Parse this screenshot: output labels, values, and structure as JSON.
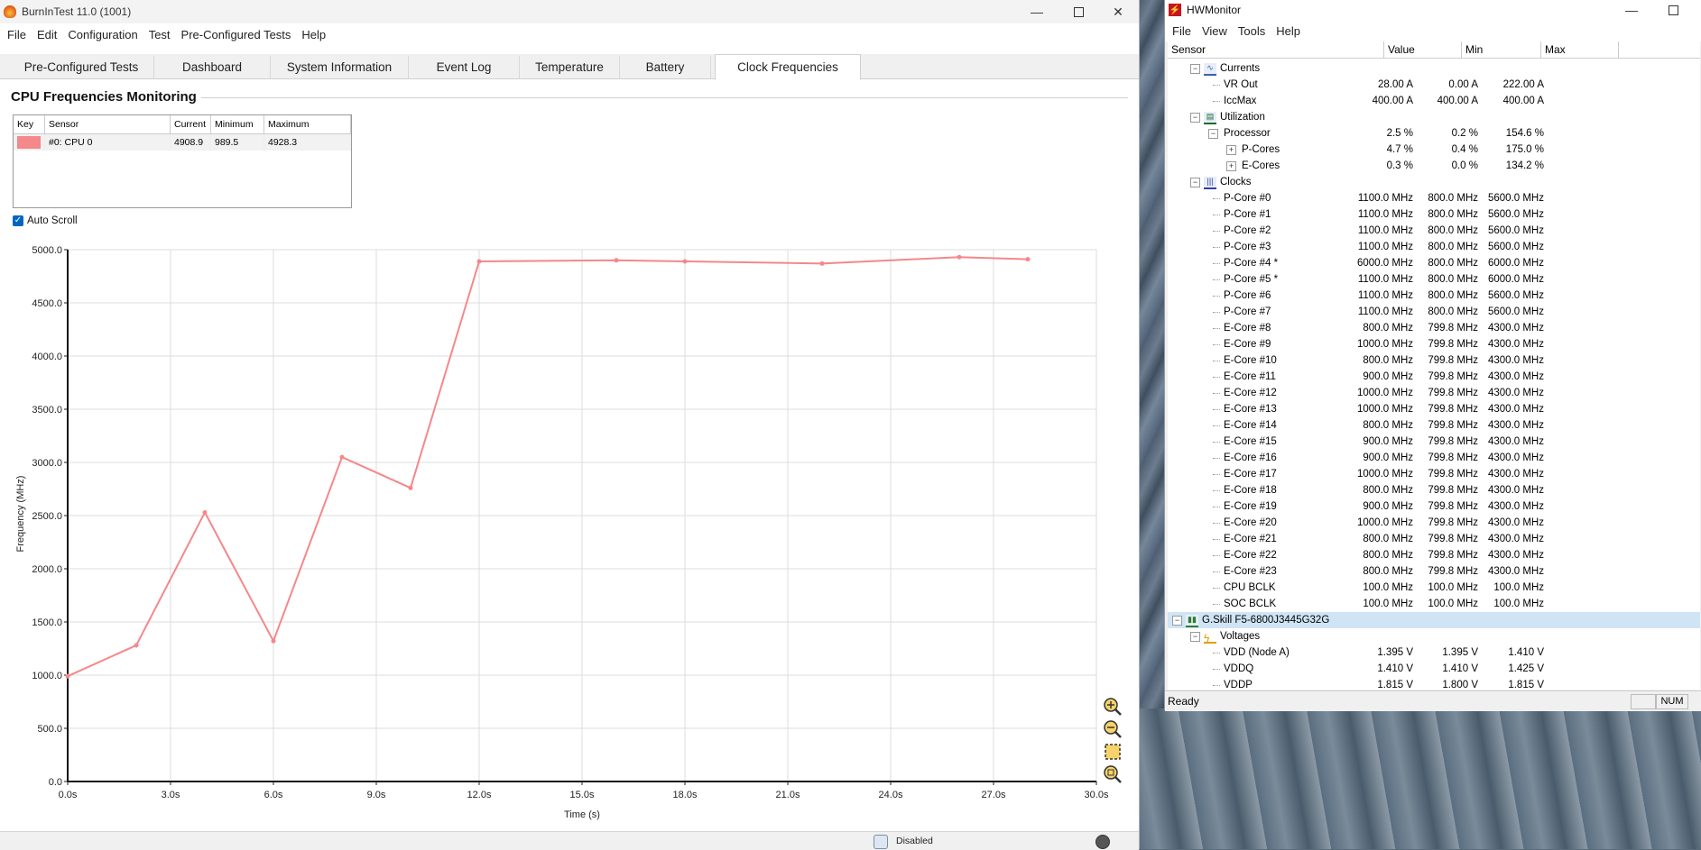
{
  "burnintest": {
    "title": "BurnInTest 11.0 (1001)",
    "menu": [
      "File",
      "Edit",
      "Configuration",
      "Test",
      "Pre-Configured Tests",
      "Help"
    ],
    "tabs": [
      "Pre-Configured Tests",
      "Dashboard",
      "System Information",
      "Event Log",
      "Temperature",
      "Battery",
      "Clock Frequencies"
    ],
    "active_tab": "Clock Frequencies",
    "section_title": "CPU Frequencies Monitoring",
    "sensor_table": {
      "headers": [
        "Key",
        "Sensor",
        "Current",
        "Minimum",
        "Maximum"
      ],
      "row": {
        "key_color": "#f4888a",
        "sensor": "#0: CPU 0",
        "current": "4908.9",
        "minimum": "989.5",
        "maximum": "4928.3"
      }
    },
    "auto_scroll_label": "Auto Scroll",
    "auto_scroll_checked": true,
    "status": {
      "text": "Disabled"
    }
  },
  "chart_data": {
    "type": "line",
    "xlabel": "Time (s)",
    "ylabel": "Frequency (MHz)",
    "xlim": [
      0,
      30
    ],
    "ylim": [
      0,
      5000
    ],
    "x_ticks": [
      "0.0s",
      "3.0s",
      "6.0s",
      "9.0s",
      "12.0s",
      "15.0s",
      "18.0s",
      "21.0s",
      "24.0s",
      "27.0s",
      "30.0s"
    ],
    "y_ticks": [
      "0.0",
      "500.0",
      "1000.0",
      "1500.0",
      "2000.0",
      "2500.0",
      "3000.0",
      "3500.0",
      "4000.0",
      "4500.0",
      "5000.0"
    ],
    "grid": true,
    "series": [
      {
        "color": "#f4888a",
        "x": [
          0,
          2,
          4,
          6,
          8,
          10,
          12,
          16,
          18,
          22,
          26,
          28
        ],
        "y": [
          990,
          1280,
          2530,
          1320,
          3050,
          2760,
          4890,
          4900,
          4890,
          4870,
          4930,
          4910
        ]
      }
    ]
  },
  "hwmonitor": {
    "title": "HWMonitor",
    "menu": [
      "File",
      "View",
      "Tools",
      "Help"
    ],
    "columns": [
      "Sensor",
      "Value",
      "Min",
      "Max"
    ],
    "rows": [
      {
        "level": 2,
        "type": "group",
        "icon": "currents",
        "label": "Currents",
        "toggle": "-"
      },
      {
        "level": 3,
        "label": "VR Out",
        "value": "28.00 A",
        "min": "0.00 A",
        "max": "222.00 A"
      },
      {
        "level": 3,
        "label": "IccMax",
        "value": "400.00 A",
        "min": "400.00 A",
        "max": "400.00 A"
      },
      {
        "level": 2,
        "type": "group",
        "icon": "utilization",
        "label": "Utilization",
        "toggle": "-"
      },
      {
        "level": 3,
        "label": "Processor",
        "value": "2.5 %",
        "min": "0.2 %",
        "max": "154.6 %",
        "toggle": "-"
      },
      {
        "level": 4,
        "label": "P-Cores",
        "value": "4.7 %",
        "min": "0.4 %",
        "max": "175.0 %",
        "toggle": "+"
      },
      {
        "level": 4,
        "label": "E-Cores",
        "value": "0.3 %",
        "min": "0.0 %",
        "max": "134.2 %",
        "toggle": "+"
      },
      {
        "level": 2,
        "type": "group",
        "icon": "clocks",
        "label": "Clocks",
        "toggle": "-"
      },
      {
        "level": 3,
        "label": "P-Core #0",
        "value": "1100.0 MHz",
        "min": "800.0 MHz",
        "max": "5600.0 MHz"
      },
      {
        "level": 3,
        "label": "P-Core #1",
        "value": "1100.0 MHz",
        "min": "800.0 MHz",
        "max": "5600.0 MHz"
      },
      {
        "level": 3,
        "label": "P-Core #2",
        "value": "1100.0 MHz",
        "min": "800.0 MHz",
        "max": "5600.0 MHz"
      },
      {
        "level": 3,
        "label": "P-Core #3",
        "value": "1100.0 MHz",
        "min": "800.0 MHz",
        "max": "5600.0 MHz"
      },
      {
        "level": 3,
        "label": "P-Core #4 *",
        "value": "6000.0 MHz",
        "min": "800.0 MHz",
        "max": "6000.0 MHz"
      },
      {
        "level": 3,
        "label": "P-Core #5 *",
        "value": "1100.0 MHz",
        "min": "800.0 MHz",
        "max": "6000.0 MHz"
      },
      {
        "level": 3,
        "label": "P-Core #6",
        "value": "1100.0 MHz",
        "min": "800.0 MHz",
        "max": "5600.0 MHz"
      },
      {
        "level": 3,
        "label": "P-Core #7",
        "value": "1100.0 MHz",
        "min": "800.0 MHz",
        "max": "5600.0 MHz"
      },
      {
        "level": 3,
        "label": "E-Core #8",
        "value": "800.0 MHz",
        "min": "799.8 MHz",
        "max": "4300.0 MHz"
      },
      {
        "level": 3,
        "label": "E-Core #9",
        "value": "1000.0 MHz",
        "min": "799.8 MHz",
        "max": "4300.0 MHz"
      },
      {
        "level": 3,
        "label": "E-Core #10",
        "value": "800.0 MHz",
        "min": "799.8 MHz",
        "max": "4300.0 MHz"
      },
      {
        "level": 3,
        "label": "E-Core #11",
        "value": "900.0 MHz",
        "min": "799.8 MHz",
        "max": "4300.0 MHz"
      },
      {
        "level": 3,
        "label": "E-Core #12",
        "value": "1000.0 MHz",
        "min": "799.8 MHz",
        "max": "4300.0 MHz"
      },
      {
        "level": 3,
        "label": "E-Core #13",
        "value": "1000.0 MHz",
        "min": "799.8 MHz",
        "max": "4300.0 MHz"
      },
      {
        "level": 3,
        "label": "E-Core #14",
        "value": "800.0 MHz",
        "min": "799.8 MHz",
        "max": "4300.0 MHz"
      },
      {
        "level": 3,
        "label": "E-Core #15",
        "value": "900.0 MHz",
        "min": "799.8 MHz",
        "max": "4300.0 MHz"
      },
      {
        "level": 3,
        "label": "E-Core #16",
        "value": "900.0 MHz",
        "min": "799.8 MHz",
        "max": "4300.0 MHz"
      },
      {
        "level": 3,
        "label": "E-Core #17",
        "value": "1000.0 MHz",
        "min": "799.8 MHz",
        "max": "4300.0 MHz"
      },
      {
        "level": 3,
        "label": "E-Core #18",
        "value": "800.0 MHz",
        "min": "799.8 MHz",
        "max": "4300.0 MHz"
      },
      {
        "level": 3,
        "label": "E-Core #19",
        "value": "900.0 MHz",
        "min": "799.8 MHz",
        "max": "4300.0 MHz"
      },
      {
        "level": 3,
        "label": "E-Core #20",
        "value": "1000.0 MHz",
        "min": "799.8 MHz",
        "max": "4300.0 MHz"
      },
      {
        "level": 3,
        "label": "E-Core #21",
        "value": "800.0 MHz",
        "min": "799.8 MHz",
        "max": "4300.0 MHz"
      },
      {
        "level": 3,
        "label": "E-Core #22",
        "value": "800.0 MHz",
        "min": "799.8 MHz",
        "max": "4300.0 MHz"
      },
      {
        "level": 3,
        "label": "E-Core #23",
        "value": "800.0 MHz",
        "min": "799.8 MHz",
        "max": "4300.0 MHz"
      },
      {
        "level": 3,
        "label": "CPU BCLK",
        "value": "100.0 MHz",
        "min": "100.0 MHz",
        "max": "100.0 MHz"
      },
      {
        "level": 3,
        "label": "SOC BCLK",
        "value": "100.0 MHz",
        "min": "100.0 MHz",
        "max": "100.0 MHz"
      },
      {
        "level": 1,
        "type": "device",
        "icon": "memory",
        "label": "G.Skill F5-6800J3445G32G",
        "toggle": "-",
        "highlight": true
      },
      {
        "level": 2,
        "type": "group",
        "icon": "voltages",
        "label": "Voltages",
        "toggle": "-"
      },
      {
        "level": 3,
        "label": "VDD (Node A)",
        "value": "1.395 V",
        "min": "1.395 V",
        "max": "1.410 V"
      },
      {
        "level": 3,
        "label": "VDDQ",
        "value": "1.410 V",
        "min": "1.410 V",
        "max": "1.425 V"
      },
      {
        "level": 3,
        "label": "VDDP",
        "value": "1.815 V",
        "min": "1.800 V",
        "max": "1.815 V"
      }
    ],
    "status": "Ready",
    "num_indicator": "NUM"
  }
}
